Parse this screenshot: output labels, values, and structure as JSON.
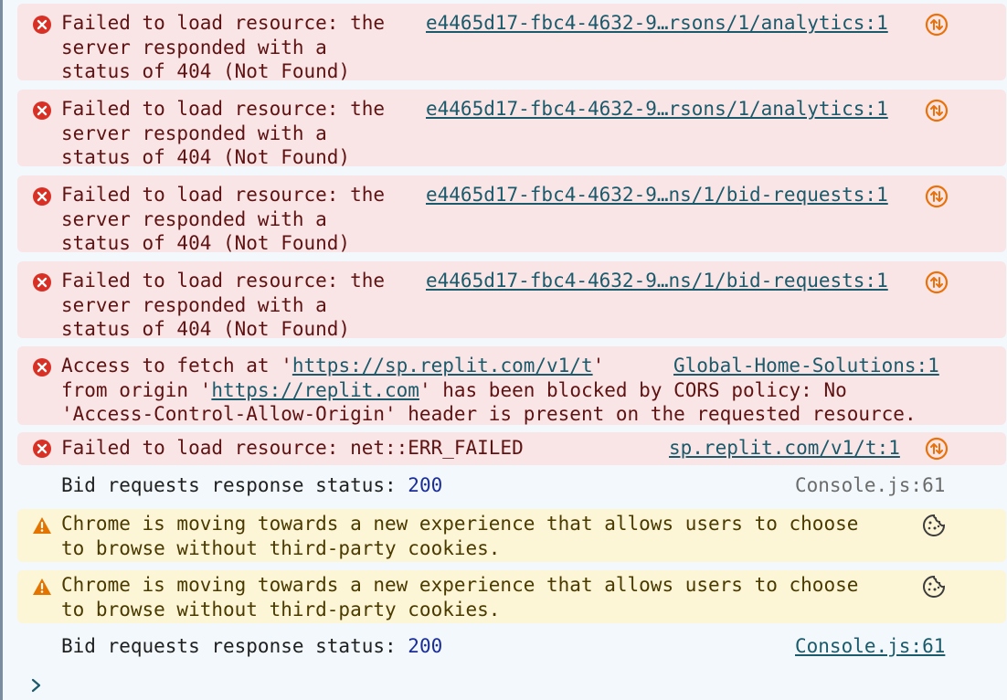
{
  "messages": [
    {
      "level": "error",
      "lines": [
        "Failed to load resource: the",
        "server responded with a",
        "status of 404 (Not Found)"
      ],
      "source": "e4465d17-fbc4-4632-9…rsons/1/analytics:1"
    },
    {
      "level": "error",
      "lines": [
        "Failed to load resource: the",
        "server responded with a",
        "status of 404 (Not Found)"
      ],
      "source": "e4465d17-fbc4-4632-9…rsons/1/analytics:1"
    },
    {
      "level": "error",
      "lines": [
        "Failed to load resource: the",
        "server responded with a",
        "status of 404 (Not Found)"
      ],
      "source": "e4465d17-fbc4-4632-9…ns/1/bid-requests:1"
    },
    {
      "level": "error",
      "lines": [
        "Failed to load resource: the",
        "server responded with a",
        "status of 404 (Not Found)"
      ],
      "source": "e4465d17-fbc4-4632-9…ns/1/bid-requests:1"
    },
    {
      "level": "error",
      "cors": {
        "prefix": "Access to fetch at '",
        "url1": "https://sp.replit.com/v1/t",
        "mid1": "'",
        "line2_prefix": "from origin '",
        "url2": "https://replit.com",
        "line2_suffix": "' has been blocked by CORS policy: No",
        "line3": "'Access-Control-Allow-Origin' header is present on the requested resource."
      },
      "source": "Global-Home-Solutions:1"
    },
    {
      "level": "error",
      "text": "Failed to load resource: net::ERR_FAILED",
      "source": "sp.replit.com/v1/t:1"
    },
    {
      "level": "info",
      "label": "Bid requests response status: ",
      "value": "200",
      "source": "Console.js:61"
    },
    {
      "level": "warn",
      "lines": [
        "Chrome is moving towards a new experience that allows users to choose",
        "to browse without third-party cookies."
      ]
    },
    {
      "level": "warn",
      "lines": [
        "Chrome is moving towards a new experience that allows users to choose",
        "to browse without third-party cookies."
      ]
    },
    {
      "level": "info",
      "label": "Bid requests response status: ",
      "value": "200",
      "source": "Console.js:61"
    }
  ],
  "colors": {
    "error_bg": "#fae5e6",
    "warn_bg": "#fcf5d6",
    "error_icon": "#d93025",
    "warn_icon": "#e37400",
    "network_badge": "#e8710a",
    "link": "#1a5a6b",
    "number": "#1a2d99"
  },
  "icons": {
    "error": "error-circle-icon",
    "warn": "warning-triangle-icon",
    "network": "network-request-icon",
    "cookie": "cookie-icon",
    "prompt": "chevron-right-icon"
  }
}
